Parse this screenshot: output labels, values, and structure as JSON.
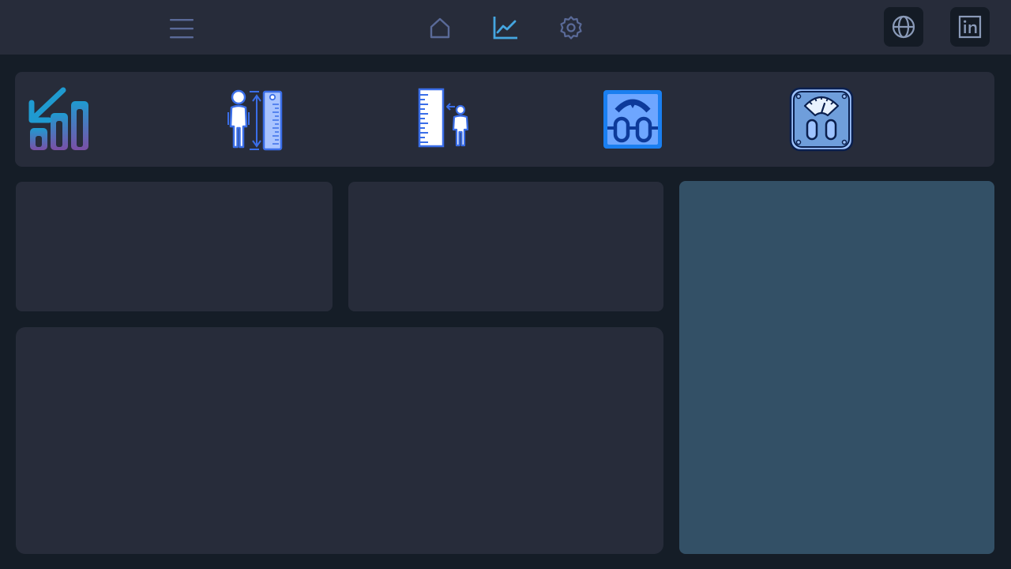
{
  "colors": {
    "background": "#151d27",
    "panel": "#272c3a",
    "side_panel": "#335066",
    "nav_icon": "#5a6a98",
    "nav_icon_active": "#45a6e0",
    "action_icon": "#8a9ab8"
  },
  "topbar": {
    "menu_icon": "hamburger-menu-icon",
    "nav_items": [
      {
        "icon": "home-icon",
        "active": false
      },
      {
        "icon": "line-chart-icon",
        "active": true
      },
      {
        "icon": "gear-icon",
        "active": false
      }
    ],
    "actions": [
      {
        "icon": "globe-icon"
      },
      {
        "icon": "linkedin-icon"
      }
    ]
  },
  "metrics": [
    {
      "icon": "weight-loss-chart-icon"
    },
    {
      "icon": "person-height-ruler-icon"
    },
    {
      "icon": "ruler-child-height-icon"
    },
    {
      "icon": "body-scale-icon"
    },
    {
      "icon": "analog-scale-icon"
    }
  ]
}
